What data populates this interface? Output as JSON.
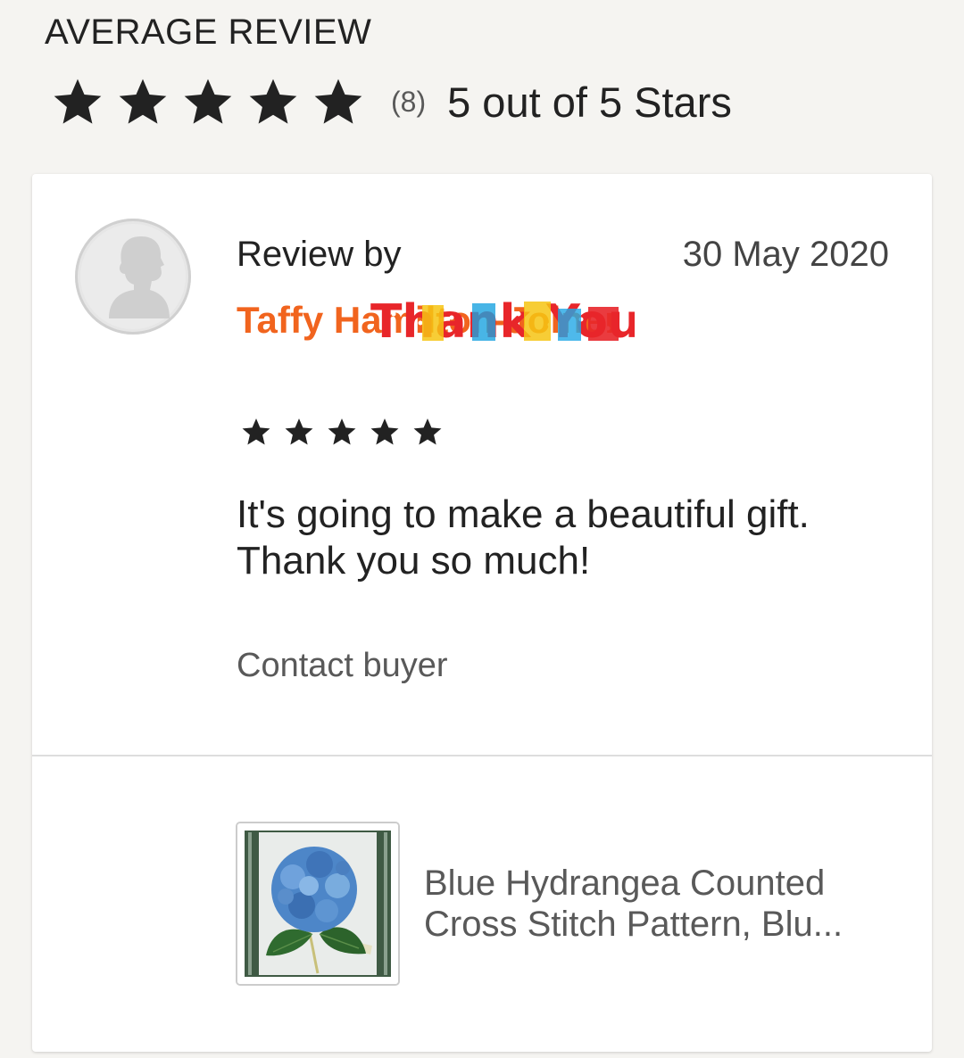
{
  "summary": {
    "title": "AVERAGE REVIEW",
    "rating": 5,
    "max_rating": 5,
    "count_text": "(8)",
    "rating_text": "5 out of 5 Stars",
    "star_icon": "star-icon"
  },
  "review": {
    "by_label": "Review by",
    "date": "30 May 2020",
    "reviewer_name": "Taffy Hamilton-Joiner",
    "sticker_text": "Thank You",
    "rating": 5,
    "text": "It's going to make a beautiful gift. Thank you so much!",
    "contact_label": "Contact buyer",
    "avatar_icon": "default-avatar-icon"
  },
  "product": {
    "title_line1": "Blue Hydrangea Counted",
    "title_line2": "Cross Stitch Pattern, Blu...",
    "thumbnail": "blue-hydrangea-thumbnail"
  },
  "colors": {
    "page_bg": "#f5f4f1",
    "card_bg": "#ffffff",
    "reviewer_name": "#f1641e",
    "star": "#222222",
    "secondary_text": "#595959"
  }
}
